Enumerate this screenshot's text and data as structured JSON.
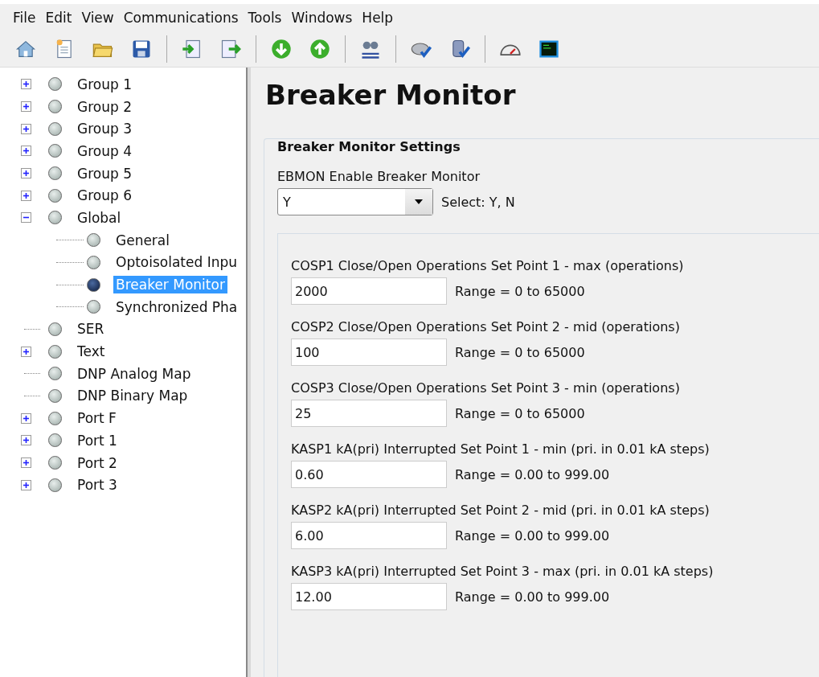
{
  "menu": [
    "File",
    "Edit",
    "View",
    "Communications",
    "Tools",
    "Windows",
    "Help"
  ],
  "tree": [
    {
      "label": "Group 1",
      "expandable": true,
      "expanded": false,
      "selected": false
    },
    {
      "label": "Group 2",
      "expandable": true,
      "expanded": false,
      "selected": false
    },
    {
      "label": "Group 3",
      "expandable": true,
      "expanded": false,
      "selected": false
    },
    {
      "label": "Group 4",
      "expandable": true,
      "expanded": false,
      "selected": false
    },
    {
      "label": "Group 5",
      "expandable": true,
      "expanded": false,
      "selected": false
    },
    {
      "label": "Group 6",
      "expandable": true,
      "expanded": false,
      "selected": false
    },
    {
      "label": "Global",
      "expandable": true,
      "expanded": true,
      "selected": false,
      "children": [
        {
          "label": "General",
          "selected": false
        },
        {
          "label": "Optoisolated Inpu",
          "selected": false
        },
        {
          "label": "Breaker Monitor",
          "selected": true
        },
        {
          "label": "Synchronized Pha",
          "selected": false
        }
      ]
    },
    {
      "label": "SER",
      "expandable": false,
      "selected": false
    },
    {
      "label": "Text",
      "expandable": true,
      "expanded": false,
      "selected": false
    },
    {
      "label": "DNP Analog Map",
      "expandable": false,
      "selected": false
    },
    {
      "label": "DNP Binary Map",
      "expandable": false,
      "selected": false
    },
    {
      "label": "Port F",
      "expandable": true,
      "expanded": false,
      "selected": false
    },
    {
      "label": "Port 1",
      "expandable": true,
      "expanded": false,
      "selected": false
    },
    {
      "label": "Port 2",
      "expandable": true,
      "expanded": false,
      "selected": false
    },
    {
      "label": "Port 3",
      "expandable": true,
      "expanded": false,
      "selected": false
    }
  ],
  "page_title": "Breaker Monitor",
  "settings_group": {
    "title": "Breaker Monitor Settings",
    "enable": {
      "label": "EBMON  Enable Breaker Monitor",
      "value": "Y",
      "hint": "Select: Y, N"
    },
    "fields": [
      {
        "label": "COSP1  Close/Open Operations Set Point 1 - max (operations)",
        "value": "2000",
        "range": "Range = 0 to 65000"
      },
      {
        "label": "COSP2  Close/Open Operations Set Point 2 - mid (operations)",
        "value": "100",
        "range": "Range = 0 to 65000"
      },
      {
        "label": "COSP3  Close/Open Operations Set Point 3 - min (operations)",
        "value": "25",
        "range": "Range = 0 to 65000"
      },
      {
        "label": "KASP1  kA(pri) Interrupted Set Point 1 - min (pri. in 0.01 kA steps)",
        "value": "0.60",
        "range": "Range = 0.00 to 999.00"
      },
      {
        "label": "KASP2  kA(pri) Interrupted Set Point 2 - mid (pri. in 0.01 kA steps)",
        "value": "6.00",
        "range": "Range = 0.00 to 999.00"
      },
      {
        "label": "KASP3  kA(pri) Interrupted Set Point 3 - max (pri. in 0.01 kA steps)",
        "value": "12.00",
        "range": "Range = 0.00 to 999.00"
      }
    ]
  }
}
